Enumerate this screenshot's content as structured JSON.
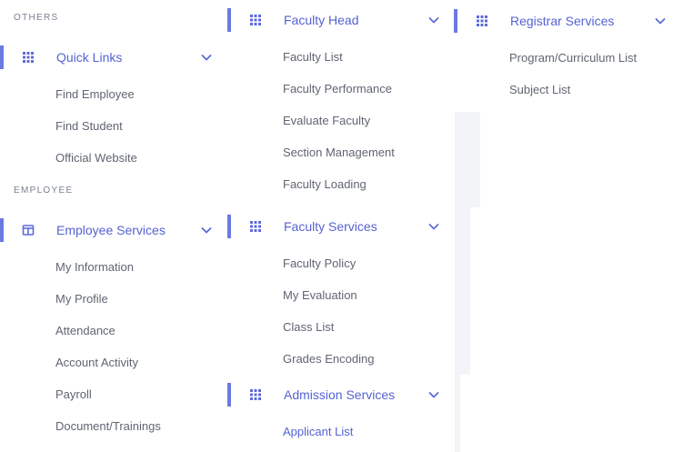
{
  "colors": {
    "accent": "#5563d2",
    "indicator": "#6c79e0",
    "text_muted": "#606572",
    "section_label": "#7b8190",
    "panel_bg": "#f3f4f8"
  },
  "column1": {
    "sections": [
      {
        "label": "OTHERS",
        "menu": {
          "label": "Quick Links",
          "icon": "grid-icon",
          "items": [
            "Find Employee",
            "Find Student",
            "Official Website"
          ]
        }
      },
      {
        "label": "EMPLOYEE",
        "menu": {
          "label": "Employee Services",
          "icon": "layout-columns-icon",
          "items": [
            "My Information",
            "My Profile",
            "Attendance",
            "Account Activity",
            "Payroll",
            "Document/Trainings"
          ]
        }
      }
    ]
  },
  "column2": {
    "menus": [
      {
        "label": "Faculty Head",
        "icon": "grid-icon",
        "items": [
          "Faculty List",
          "Faculty Performance",
          "Evaluate Faculty",
          "Section Management",
          "Faculty Loading"
        ]
      },
      {
        "label": "Faculty Services",
        "icon": "grid-icon",
        "items": [
          "Faculty Policy",
          "My Evaluation",
          "Class List",
          "Grades Encoding"
        ]
      },
      {
        "label": "Admission Services",
        "icon": "grid-icon",
        "items": [
          "Applicant List"
        ]
      }
    ]
  },
  "column3": {
    "menus": [
      {
        "label": "Registrar Services",
        "icon": "grid-icon",
        "items": [
          "Program/Curriculum List",
          "Subject List"
        ]
      }
    ]
  }
}
